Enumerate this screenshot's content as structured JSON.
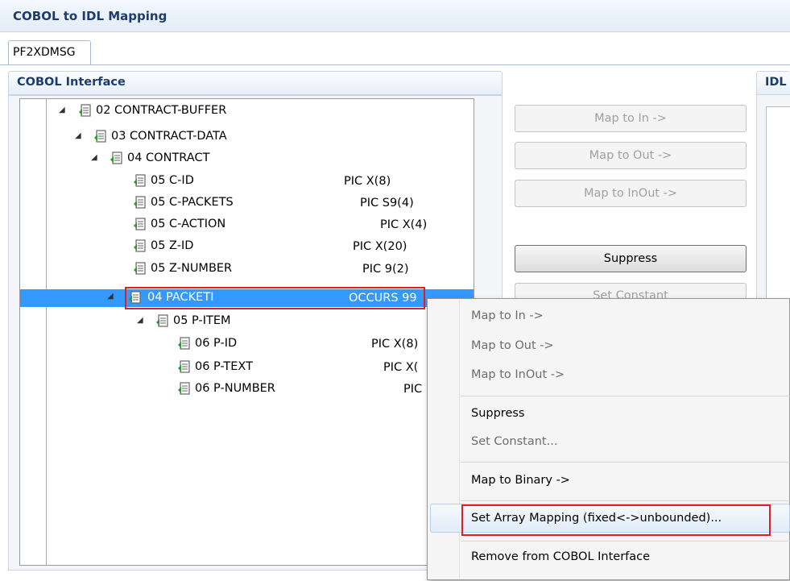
{
  "window": {
    "title": "COBOL to IDL Mapping"
  },
  "tab": {
    "label": "PF2XDMSG"
  },
  "cobol_panel": {
    "title": "COBOL Interface"
  },
  "idl_panel": {
    "title": "IDL"
  },
  "tree": {
    "rows": [
      {
        "label": "02 CONTRACT-BUFFER",
        "pic": ""
      },
      {
        "label": "03 CONTRACT-DATA",
        "pic": ""
      },
      {
        "label": "04 CONTRACT",
        "pic": ""
      },
      {
        "label": "05 C-ID",
        "pic": "PIC X(8)"
      },
      {
        "label": "05 C-PACKETS",
        "pic": "PIC S9(4)"
      },
      {
        "label": "05 C-ACTION",
        "pic": "PIC X(4)"
      },
      {
        "label": "05 Z-ID",
        "pic": "PIC X(20)"
      },
      {
        "label": "05 Z-NUMBER",
        "pic": "PIC 9(2)"
      },
      {
        "label": "04 PACKETI",
        "pic": "OCCURS 99"
      },
      {
        "label": "05 P-ITEM",
        "pic": ""
      },
      {
        "label": "06 P-ID",
        "pic": "PIC X(8)"
      },
      {
        "label": "06 P-TEXT",
        "pic": "PIC X("
      },
      {
        "label": "06 P-NUMBER",
        "pic": "PIC"
      }
    ],
    "selected_index": 8
  },
  "buttons": {
    "map_in": "Map to In ->",
    "map_out": "Map to Out ->",
    "map_inout": "Map to InOut ->",
    "suppress": "Suppress",
    "set_constant": "Set Constant"
  },
  "context_menu": {
    "map_in": "Map to In ->",
    "map_out": "Map to Out ->",
    "map_inout": "Map to InOut ->",
    "suppress": "Suppress",
    "set_constant": "Set Constant...",
    "map_binary": "Map to Binary ->",
    "set_array_mapping": "Set Array Mapping (fixed<->unbounded)...",
    "remove": "Remove from COBOL Interface"
  },
  "colors": {
    "selection": "#3399ff",
    "highlight_box": "#e02020",
    "header_text": "#1a3d6e"
  }
}
